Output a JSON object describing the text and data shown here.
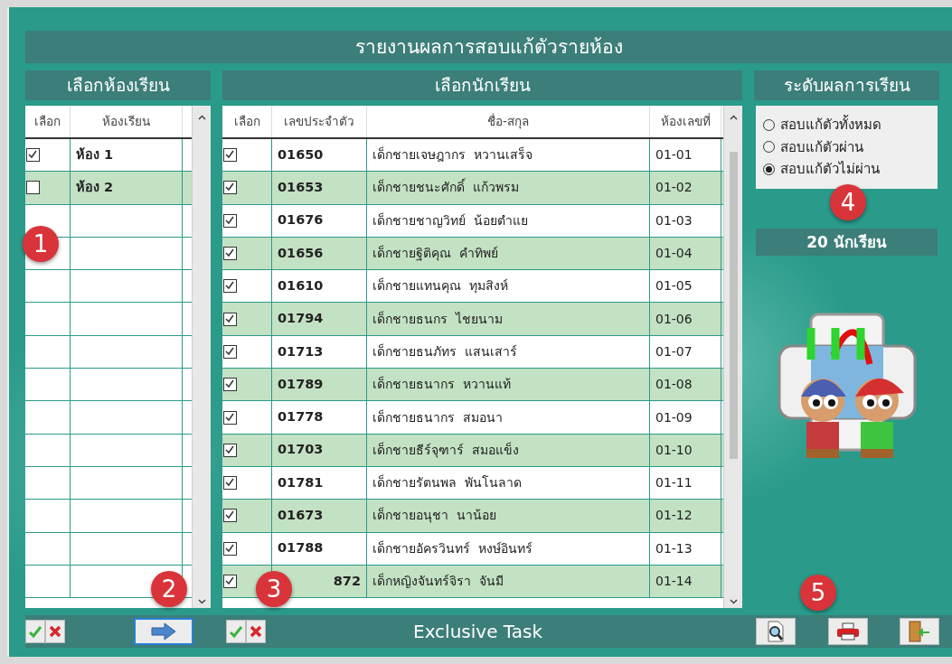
{
  "window": {
    "title": "รายงานผลการสอบแก้ตัวรายห้อง"
  },
  "rooms_panel": {
    "heading": "เลือกห้องเรียน",
    "columns": [
      "เลือก",
      "ห้องเรียน"
    ],
    "rows": [
      {
        "checked": true,
        "room": "ห้อง 1"
      },
      {
        "checked": false,
        "room": "ห้อง 2"
      }
    ]
  },
  "students_panel": {
    "heading": "เลือกนักเรียน",
    "columns": [
      "เลือก",
      "เลขประจำตัว",
      "ชื่อ-สกุล",
      "ห้องเลขที่"
    ],
    "rows": [
      {
        "checked": true,
        "id": "01650",
        "name": "เด็กชายเจษฎากร  หวานเสร็จ",
        "number": "01-01"
      },
      {
        "checked": true,
        "id": "01653",
        "name": "เด็กชายชนะศักดิ์  แก้วพรม",
        "number": "01-02"
      },
      {
        "checked": true,
        "id": "01676",
        "name": "เด็กชายชาญวิทย์  น้อยตำแย",
        "number": "01-03"
      },
      {
        "checked": true,
        "id": "01656",
        "name": "เด็กชายฐิติคุณ  คำทิพย์",
        "number": "01-04"
      },
      {
        "checked": true,
        "id": "01610",
        "name": "เด็กชายแทนคุณ  ทุมสิงห์",
        "number": "01-05"
      },
      {
        "checked": true,
        "id": "01794",
        "name": "เด็กชายธนกร  ไชยนาม",
        "number": "01-06"
      },
      {
        "checked": true,
        "id": "01713",
        "name": "เด็กชายธนภัทร  แสนเสาร์",
        "number": "01-07"
      },
      {
        "checked": true,
        "id": "01789",
        "name": "เด็กชายธนากร  หวานแท้",
        "number": "01-08"
      },
      {
        "checked": true,
        "id": "01778",
        "name": "เด็กชายธนากร  สมอนา",
        "number": "01-09"
      },
      {
        "checked": true,
        "id": "01703",
        "name": "เด็กชายธีร์จุฑาร์  สมอแข็ง",
        "number": "01-10"
      },
      {
        "checked": true,
        "id": "01781",
        "name": "เด็กชายรัตนพล  พันโนลาด",
        "number": "01-11"
      },
      {
        "checked": true,
        "id": "01673",
        "name": "เด็กชายอนุชา  นาน้อย",
        "number": "01-12"
      },
      {
        "checked": true,
        "id": "01788",
        "name": "เด็กชายอัครวินทร์  หงษ์อินทร์",
        "number": "01-13"
      },
      {
        "checked": true,
        "id": "872",
        "name": "เด็กหญิงจันทร์จิรา  จันมี",
        "number": "01-14"
      }
    ]
  },
  "level_panel": {
    "heading": "ระดับผลการเรียน",
    "options": [
      {
        "label": "สอบแก้ตัวทั้งหมด",
        "selected": false
      },
      {
        "label": "สอบแก้ตัวผ่าน",
        "selected": false
      },
      {
        "label": "สอบแก้ตัวไม่ผ่าน",
        "selected": true
      }
    ],
    "count": "20 นักเรียน"
  },
  "footer": {
    "title": "Exclusive Task",
    "transfer_focused": true
  },
  "callouts": [
    "1",
    "2",
    "3",
    "4",
    "5"
  ]
}
